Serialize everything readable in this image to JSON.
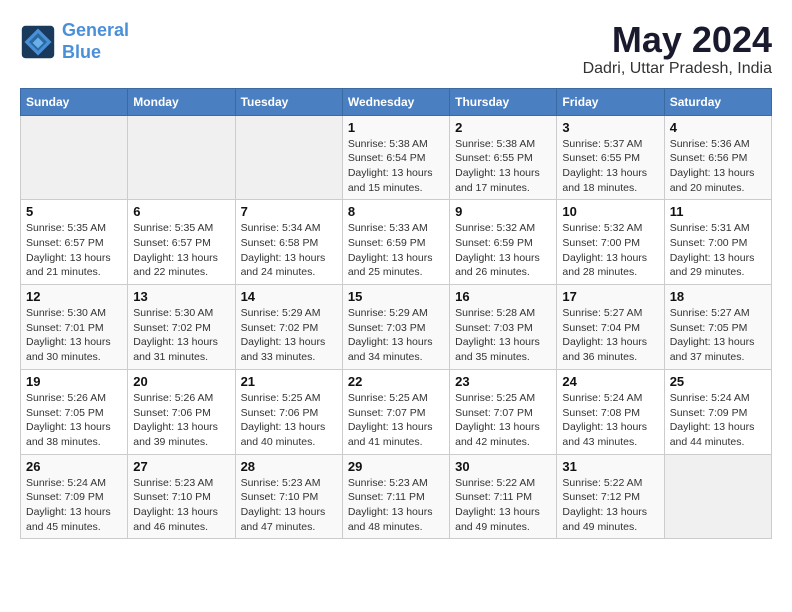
{
  "header": {
    "logo_line1": "General",
    "logo_line2": "Blue",
    "month": "May 2024",
    "location": "Dadri, Uttar Pradesh, India"
  },
  "days_of_week": [
    "Sunday",
    "Monday",
    "Tuesday",
    "Wednesday",
    "Thursday",
    "Friday",
    "Saturday"
  ],
  "weeks": [
    [
      {
        "day": "",
        "info": ""
      },
      {
        "day": "",
        "info": ""
      },
      {
        "day": "",
        "info": ""
      },
      {
        "day": "1",
        "info": "Sunrise: 5:38 AM\nSunset: 6:54 PM\nDaylight: 13 hours and 15 minutes."
      },
      {
        "day": "2",
        "info": "Sunrise: 5:38 AM\nSunset: 6:55 PM\nDaylight: 13 hours and 17 minutes."
      },
      {
        "day": "3",
        "info": "Sunrise: 5:37 AM\nSunset: 6:55 PM\nDaylight: 13 hours and 18 minutes."
      },
      {
        "day": "4",
        "info": "Sunrise: 5:36 AM\nSunset: 6:56 PM\nDaylight: 13 hours and 20 minutes."
      }
    ],
    [
      {
        "day": "5",
        "info": "Sunrise: 5:35 AM\nSunset: 6:57 PM\nDaylight: 13 hours and 21 minutes."
      },
      {
        "day": "6",
        "info": "Sunrise: 5:35 AM\nSunset: 6:57 PM\nDaylight: 13 hours and 22 minutes."
      },
      {
        "day": "7",
        "info": "Sunrise: 5:34 AM\nSunset: 6:58 PM\nDaylight: 13 hours and 24 minutes."
      },
      {
        "day": "8",
        "info": "Sunrise: 5:33 AM\nSunset: 6:59 PM\nDaylight: 13 hours and 25 minutes."
      },
      {
        "day": "9",
        "info": "Sunrise: 5:32 AM\nSunset: 6:59 PM\nDaylight: 13 hours and 26 minutes."
      },
      {
        "day": "10",
        "info": "Sunrise: 5:32 AM\nSunset: 7:00 PM\nDaylight: 13 hours and 28 minutes."
      },
      {
        "day": "11",
        "info": "Sunrise: 5:31 AM\nSunset: 7:00 PM\nDaylight: 13 hours and 29 minutes."
      }
    ],
    [
      {
        "day": "12",
        "info": "Sunrise: 5:30 AM\nSunset: 7:01 PM\nDaylight: 13 hours and 30 minutes."
      },
      {
        "day": "13",
        "info": "Sunrise: 5:30 AM\nSunset: 7:02 PM\nDaylight: 13 hours and 31 minutes."
      },
      {
        "day": "14",
        "info": "Sunrise: 5:29 AM\nSunset: 7:02 PM\nDaylight: 13 hours and 33 minutes."
      },
      {
        "day": "15",
        "info": "Sunrise: 5:29 AM\nSunset: 7:03 PM\nDaylight: 13 hours and 34 minutes."
      },
      {
        "day": "16",
        "info": "Sunrise: 5:28 AM\nSunset: 7:03 PM\nDaylight: 13 hours and 35 minutes."
      },
      {
        "day": "17",
        "info": "Sunrise: 5:27 AM\nSunset: 7:04 PM\nDaylight: 13 hours and 36 minutes."
      },
      {
        "day": "18",
        "info": "Sunrise: 5:27 AM\nSunset: 7:05 PM\nDaylight: 13 hours and 37 minutes."
      }
    ],
    [
      {
        "day": "19",
        "info": "Sunrise: 5:26 AM\nSunset: 7:05 PM\nDaylight: 13 hours and 38 minutes."
      },
      {
        "day": "20",
        "info": "Sunrise: 5:26 AM\nSunset: 7:06 PM\nDaylight: 13 hours and 39 minutes."
      },
      {
        "day": "21",
        "info": "Sunrise: 5:25 AM\nSunset: 7:06 PM\nDaylight: 13 hours and 40 minutes."
      },
      {
        "day": "22",
        "info": "Sunrise: 5:25 AM\nSunset: 7:07 PM\nDaylight: 13 hours and 41 minutes."
      },
      {
        "day": "23",
        "info": "Sunrise: 5:25 AM\nSunset: 7:07 PM\nDaylight: 13 hours and 42 minutes."
      },
      {
        "day": "24",
        "info": "Sunrise: 5:24 AM\nSunset: 7:08 PM\nDaylight: 13 hours and 43 minutes."
      },
      {
        "day": "25",
        "info": "Sunrise: 5:24 AM\nSunset: 7:09 PM\nDaylight: 13 hours and 44 minutes."
      }
    ],
    [
      {
        "day": "26",
        "info": "Sunrise: 5:24 AM\nSunset: 7:09 PM\nDaylight: 13 hours and 45 minutes."
      },
      {
        "day": "27",
        "info": "Sunrise: 5:23 AM\nSunset: 7:10 PM\nDaylight: 13 hours and 46 minutes."
      },
      {
        "day": "28",
        "info": "Sunrise: 5:23 AM\nSunset: 7:10 PM\nDaylight: 13 hours and 47 minutes."
      },
      {
        "day": "29",
        "info": "Sunrise: 5:23 AM\nSunset: 7:11 PM\nDaylight: 13 hours and 48 minutes."
      },
      {
        "day": "30",
        "info": "Sunrise: 5:22 AM\nSunset: 7:11 PM\nDaylight: 13 hours and 49 minutes."
      },
      {
        "day": "31",
        "info": "Sunrise: 5:22 AM\nSunset: 7:12 PM\nDaylight: 13 hours and 49 minutes."
      },
      {
        "day": "",
        "info": ""
      }
    ]
  ]
}
